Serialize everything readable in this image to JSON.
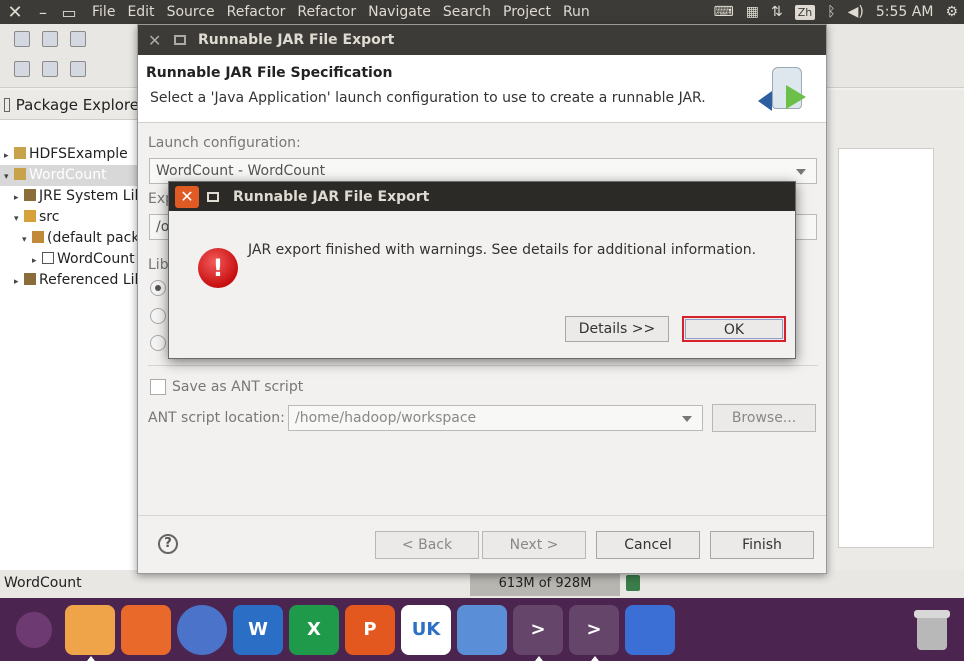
{
  "topbar": {
    "menu": [
      "File",
      "Edit",
      "Source",
      "Refactor",
      "Refactor",
      "Navigate",
      "Search",
      "Project",
      "Run"
    ],
    "input_method": "Zh",
    "clock": "5:55 AM"
  },
  "package_explorer": {
    "title": "Package Explore",
    "items": [
      {
        "label": "HDFSExample",
        "arrow": "▸"
      },
      {
        "label": "WordCount",
        "arrow": "▾"
      },
      {
        "label": "JRE System Lil",
        "arrow": "▸"
      },
      {
        "label": "src",
        "arrow": "▾"
      },
      {
        "label": "(default pack",
        "arrow": "▾"
      },
      {
        "label": "WordCount",
        "arrow": "▸"
      },
      {
        "label": "Referenced Lil",
        "arrow": "▸"
      }
    ]
  },
  "status": {
    "text": "WordCount",
    "heap": "613M of 928M"
  },
  "wizard": {
    "window_title": "Runnable JAR File Export",
    "banner_title": "Runnable JAR File Specification",
    "banner_desc": "Select a 'Java Application' launch configuration to use to create a runnable JAR.",
    "launch_label": "Launch configuration:",
    "launch_value": "WordCount - WordCount",
    "export_label": "Exp",
    "export_value": "/o",
    "library_label": "Lib",
    "save_ant_label": "Save as ANT script",
    "ant_location_label": "ANT script location:",
    "ant_location_value": "/home/hadoop/workspace",
    "browse_label": "Browse...",
    "back_label": "< Back",
    "next_label": "Next >",
    "cancel_label": "Cancel",
    "finish_label": "Finish"
  },
  "dialog": {
    "title": "Runnable JAR File Export",
    "message": "JAR export finished with warnings. See details for additional information.",
    "details_label": "Details >>",
    "ok_label": "OK"
  },
  "dock": {
    "apps": [
      {
        "name": "ubuntu-icon",
        "label": ""
      },
      {
        "name": "files-icon",
        "label": ""
      },
      {
        "name": "firefox-icon",
        "label": ""
      },
      {
        "name": "chromium-icon",
        "label": ""
      },
      {
        "name": "writer-icon",
        "label": "W"
      },
      {
        "name": "calc-icon",
        "label": "X"
      },
      {
        "name": "impress-icon",
        "label": "P"
      },
      {
        "name": "ubuntu-one-icon",
        "label": "UK"
      },
      {
        "name": "remote-icon",
        "label": ""
      },
      {
        "name": "terminal-icon",
        "label": ">"
      },
      {
        "name": "terminal2-icon",
        "label": ">"
      },
      {
        "name": "workspace-icon",
        "label": ""
      }
    ]
  }
}
